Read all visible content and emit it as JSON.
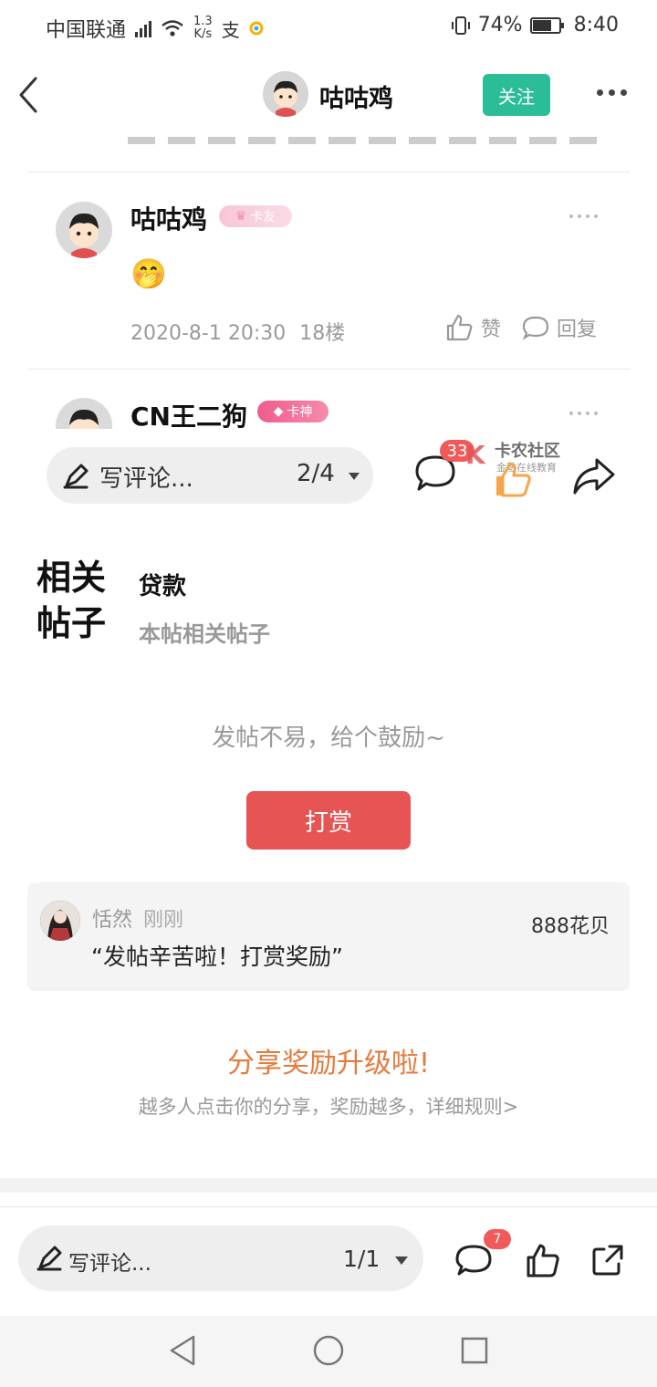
{
  "status_bar": {
    "carrier": "中国联通",
    "net_speed_value": "1.3",
    "net_speed_unit": "K/s",
    "alipay_glyph": "支",
    "battery": "74%",
    "battery_level": 0.74,
    "time": "8:40",
    "icons": [
      "signal-icon",
      "wifi-icon",
      "alipay-icon",
      "app-icon",
      "vibrate-icon",
      "battery-icon"
    ]
  },
  "header": {
    "title": "咕咕鸡",
    "follow_label": "关注",
    "follow_color": "#2bbd98"
  },
  "comments": [
    {
      "name": "咕咕鸡",
      "badge": "卡友",
      "content": "🤭",
      "date": "2020-8-1 20:30",
      "floor": "18楼",
      "like_label": "赞",
      "reply_label": "回复"
    },
    {
      "name": "CN王二狗",
      "badge": "卡神"
    }
  ],
  "comment_bar_mid": {
    "placeholder": "写评论...",
    "page": "2/4",
    "comment_count": "33",
    "watermark_title": "卡农社区",
    "watermark_sub": "金融在线教育"
  },
  "related": {
    "heading_line1": "相关",
    "heading_line2": "帖子",
    "tag": "贷款",
    "subtitle": "本帖相关帖子"
  },
  "reward": {
    "prompt": "发帖不易，给个鼓励~",
    "button_label": "打赏",
    "button_color": "#e65454",
    "record": {
      "user": "恬然",
      "time": "刚刚",
      "message": "“发帖辛苦啦！打赏奖励”",
      "amount": "888花贝"
    }
  },
  "share": {
    "title": "分享奖励升级啦!",
    "subtitle": "越多人点击你的分享，奖励越多，详细规则>",
    "title_color": "#e57a3c"
  },
  "bottom_bar": {
    "placeholder": "写评论...",
    "page": "1/1",
    "comment_badge": "7"
  }
}
